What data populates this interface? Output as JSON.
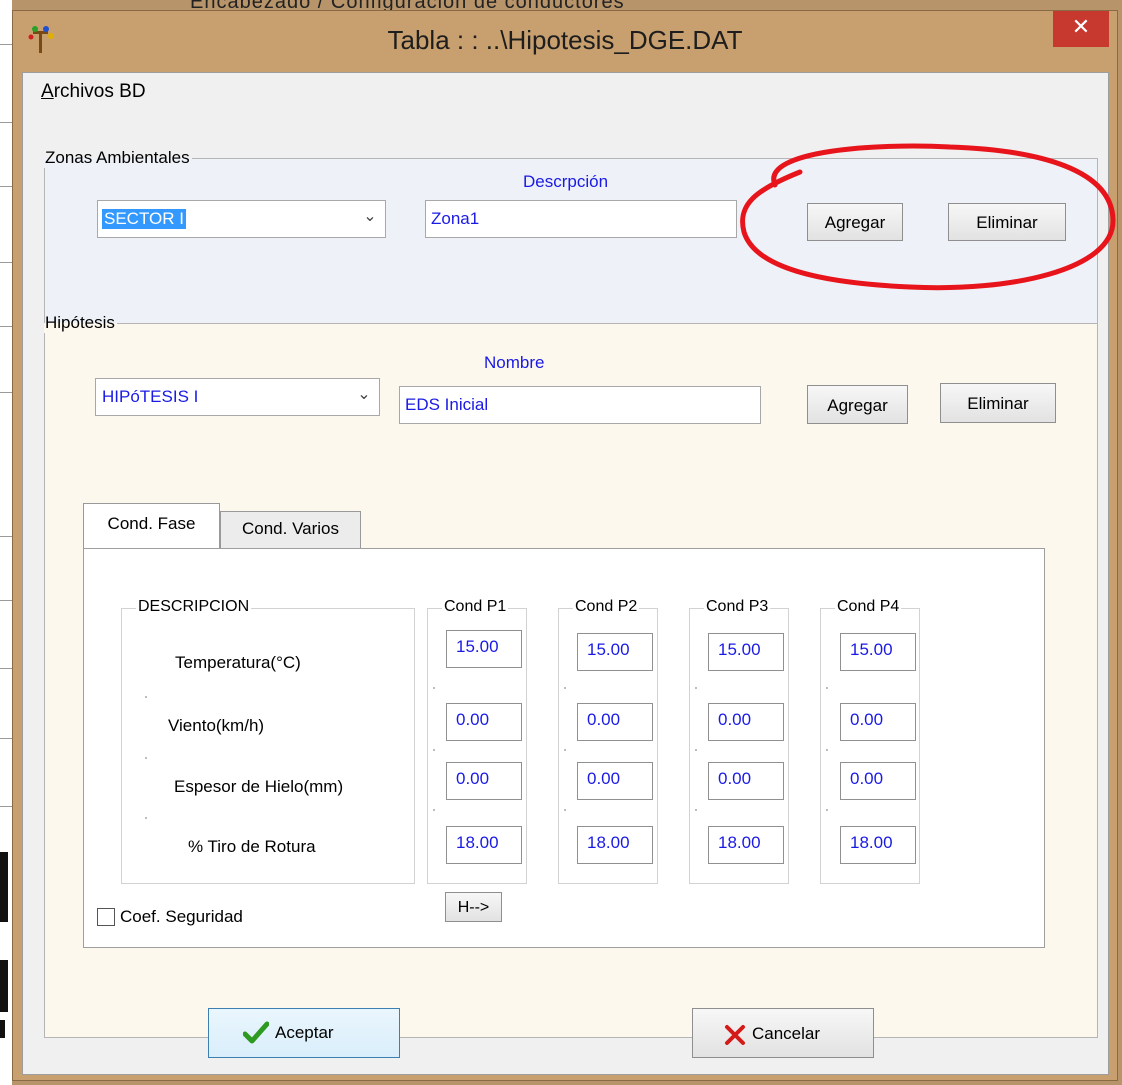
{
  "background": {
    "top_text": "Encabezado / Configuración de conductores"
  },
  "window": {
    "title": "Tabla : : ..\\Hipotesis_DGE.DAT",
    "close_glyph": "✕",
    "icon": "app-icon"
  },
  "menu": {
    "archivos_prefix": "A",
    "archivos_rest": "rchivos BD"
  },
  "zonas": {
    "legend": "Zonas Ambientales",
    "descripcion_label": "Descrpción",
    "selected_sector": "SECTOR I",
    "descripcion_value": "Zona1",
    "agregar_label": "Agregar",
    "eliminar_label": "Eliminar"
  },
  "hipotesis": {
    "legend": "Hipótesis",
    "nombre_label": "Nombre",
    "selected_hipotesis": "HIPóTESIS I",
    "nombre_value": "EDS Inicial",
    "agregar_label": "Agregar",
    "eliminar_label": "Eliminar"
  },
  "tabs": [
    {
      "label": "Cond. Fase"
    },
    {
      "label": "Cond. Varios"
    }
  ],
  "table": {
    "descripcion_header": "DESCRIPCION",
    "rows": [
      {
        "label": "Temperatura(°C)"
      },
      {
        "label": "Viento(km/h)"
      },
      {
        "label": "Espesor de Hielo(mm)"
      },
      {
        "label": "% Tiro de Rotura"
      }
    ],
    "columns": [
      {
        "header": "Cond P1",
        "values": [
          "15.00",
          "0.00",
          "0.00",
          "18.00"
        ]
      },
      {
        "header": "Cond P2",
        "values": [
          "15.00",
          "0.00",
          "0.00",
          "18.00"
        ]
      },
      {
        "header": "Cond P3",
        "values": [
          "15.00",
          "0.00",
          "0.00",
          "18.00"
        ]
      },
      {
        "header": "Cond P4",
        "values": [
          "15.00",
          "0.00",
          "0.00",
          "18.00"
        ]
      }
    ],
    "h_button_label": "H-->"
  },
  "coef_seguridad": {
    "label": "Coef. Seguridad",
    "checked": false
  },
  "footer": {
    "aceptar_label": "Aceptar",
    "cancelar_label": "Cancelar"
  },
  "colors": {
    "accent_blue": "#1a1ae6",
    "selection_blue": "#3399ff",
    "annotation_red": "#e8141b",
    "close_red": "#c7382f"
  }
}
